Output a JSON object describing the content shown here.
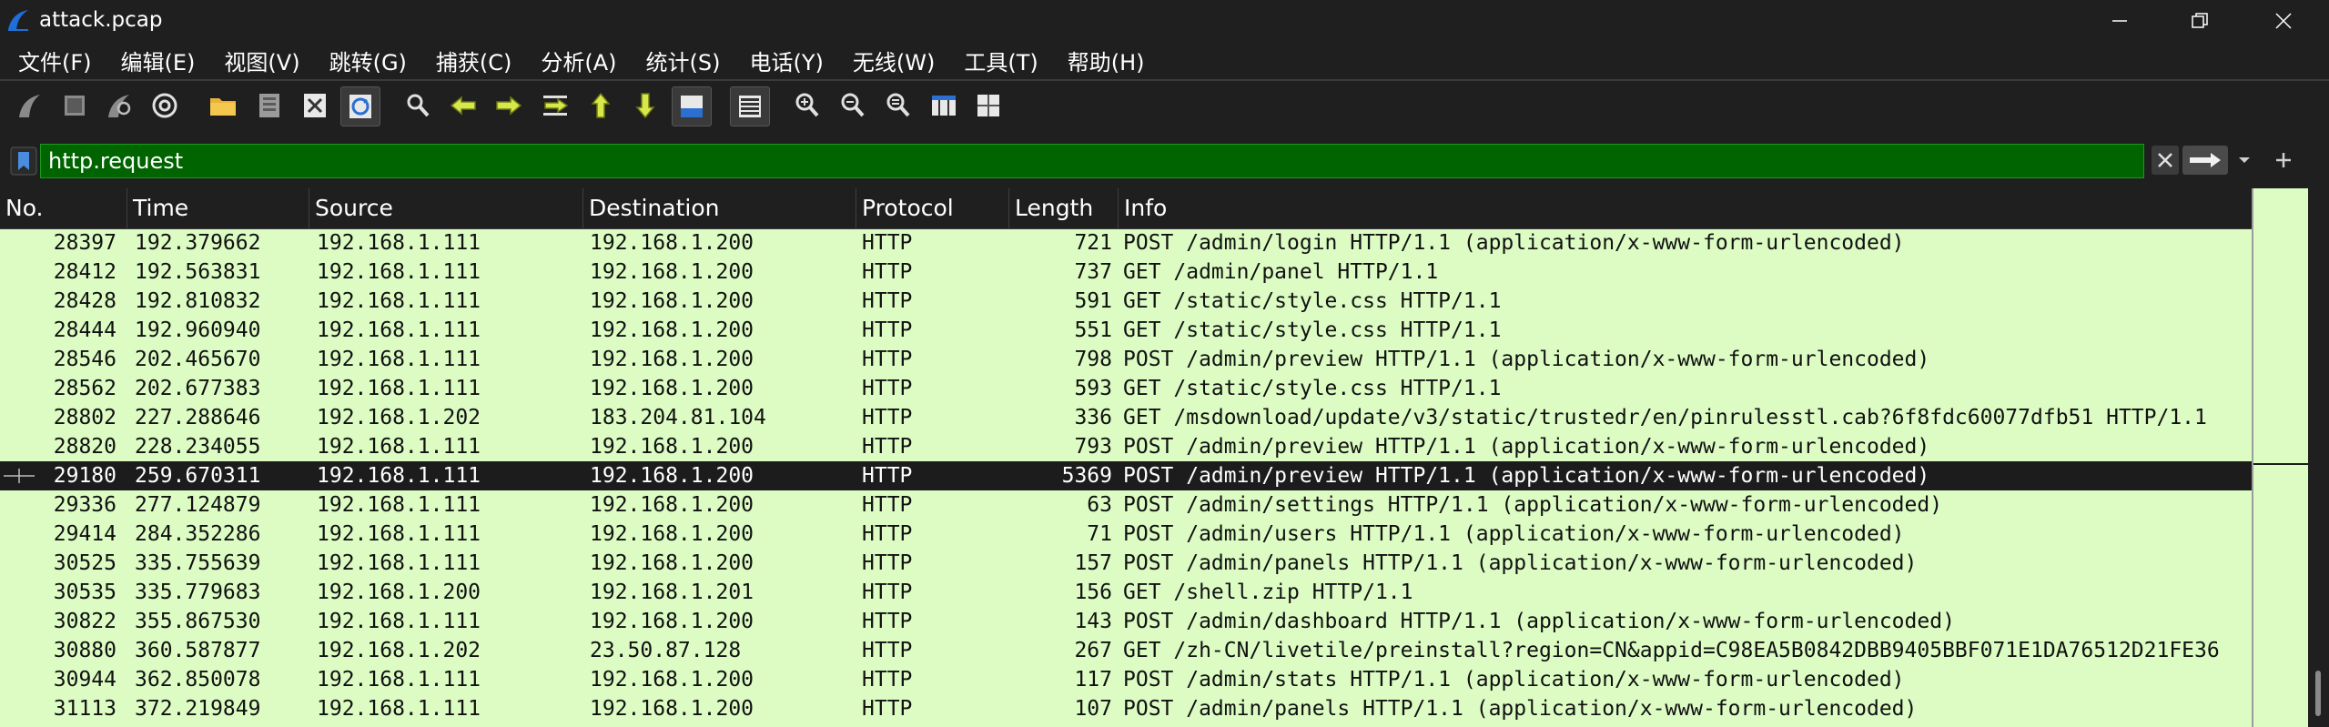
{
  "window": {
    "title": "attack.pcap"
  },
  "menu": [
    "文件(F)",
    "编辑(E)",
    "视图(V)",
    "跳转(G)",
    "捕获(C)",
    "分析(A)",
    "统计(S)",
    "电话(Y)",
    "无线(W)",
    "工具(T)",
    "帮助(H)"
  ],
  "toolbar_icons": [
    "start-capture-icon",
    "stop-capture-icon",
    "restart-capture-icon",
    "capture-options-icon",
    "open-file-icon",
    "save-file-icon",
    "close-file-icon",
    "reload-file-icon",
    "find-packet-icon",
    "go-back-icon",
    "go-forward-icon",
    "go-to-packet-icon",
    "first-packet-icon",
    "last-packet-icon",
    "auto-scroll-icon",
    "colorize-icon",
    "zoom-in-icon",
    "zoom-out-icon",
    "normal-size-icon",
    "resize-columns-icon"
  ],
  "filter": {
    "value": "http.request"
  },
  "columns": [
    "No.",
    "Time",
    "Source",
    "Destination",
    "Protocol",
    "Length",
    "Info"
  ],
  "packets": [
    {
      "no": "28397",
      "time": "192.379662",
      "src": "192.168.1.111",
      "dst": "192.168.1.200",
      "proto": "HTTP",
      "len": "721",
      "info": "POST /admin/login HTTP/1.1  (application/x-www-form-urlencoded)"
    },
    {
      "no": "28412",
      "time": "192.563831",
      "src": "192.168.1.111",
      "dst": "192.168.1.200",
      "proto": "HTTP",
      "len": "737",
      "info": "GET /admin/panel HTTP/1.1"
    },
    {
      "no": "28428",
      "time": "192.810832",
      "src": "192.168.1.111",
      "dst": "192.168.1.200",
      "proto": "HTTP",
      "len": "591",
      "info": "GET /static/style.css HTTP/1.1"
    },
    {
      "no": "28444",
      "time": "192.960940",
      "src": "192.168.1.111",
      "dst": "192.168.1.200",
      "proto": "HTTP",
      "len": "551",
      "info": "GET /static/style.css HTTP/1.1"
    },
    {
      "no": "28546",
      "time": "202.465670",
      "src": "192.168.1.111",
      "dst": "192.168.1.200",
      "proto": "HTTP",
      "len": "798",
      "info": "POST /admin/preview HTTP/1.1  (application/x-www-form-urlencoded)"
    },
    {
      "no": "28562",
      "time": "202.677383",
      "src": "192.168.1.111",
      "dst": "192.168.1.200",
      "proto": "HTTP",
      "len": "593",
      "info": "GET /static/style.css HTTP/1.1"
    },
    {
      "no": "28802",
      "time": "227.288646",
      "src": "192.168.1.202",
      "dst": "183.204.81.104",
      "proto": "HTTP",
      "len": "336",
      "info": "GET /msdownload/update/v3/static/trustedr/en/pinrulesstl.cab?6f8fdc60077dfb51 HTTP/1.1"
    },
    {
      "no": "28820",
      "time": "228.234055",
      "src": "192.168.1.111",
      "dst": "192.168.1.200",
      "proto": "HTTP",
      "len": "793",
      "info": "POST /admin/preview HTTP/1.1  (application/x-www-form-urlencoded)"
    },
    {
      "no": "29180",
      "time": "259.670311",
      "src": "192.168.1.111",
      "dst": "192.168.1.200",
      "proto": "HTTP",
      "len": "5369",
      "info": "POST /admin/preview HTTP/1.1  (application/x-www-form-urlencoded)",
      "selected": true
    },
    {
      "no": "29336",
      "time": "277.124879",
      "src": "192.168.1.111",
      "dst": "192.168.1.200",
      "proto": "HTTP",
      "len": "63",
      "info": "POST /admin/settings HTTP/1.1  (application/x-www-form-urlencoded)"
    },
    {
      "no": "29414",
      "time": "284.352286",
      "src": "192.168.1.111",
      "dst": "192.168.1.200",
      "proto": "HTTP",
      "len": "71",
      "info": "POST /admin/users HTTP/1.1  (application/x-www-form-urlencoded)"
    },
    {
      "no": "30525",
      "time": "335.755639",
      "src": "192.168.1.111",
      "dst": "192.168.1.200",
      "proto": "HTTP",
      "len": "157",
      "info": "POST /admin/panels HTTP/1.1  (application/x-www-form-urlencoded)"
    },
    {
      "no": "30535",
      "time": "335.779683",
      "src": "192.168.1.200",
      "dst": "192.168.1.201",
      "proto": "HTTP",
      "len": "156",
      "info": "GET /shell.zip HTTP/1.1"
    },
    {
      "no": "30822",
      "time": "355.867530",
      "src": "192.168.1.111",
      "dst": "192.168.1.200",
      "proto": "HTTP",
      "len": "143",
      "info": "POST /admin/dashboard HTTP/1.1  (application/x-www-form-urlencoded)"
    },
    {
      "no": "30880",
      "time": "360.587877",
      "src": "192.168.1.202",
      "dst": "23.50.87.128",
      "proto": "HTTP",
      "len": "267",
      "info": "GET /zh-CN/livetile/preinstall?region=CN&appid=C98EA5B0842DBB9405BBF071E1DA76512D21FE36"
    },
    {
      "no": "30944",
      "time": "362.850078",
      "src": "192.168.1.111",
      "dst": "192.168.1.200",
      "proto": "HTTP",
      "len": "117",
      "info": "POST /admin/stats HTTP/1.1  (application/x-www-form-urlencoded)"
    },
    {
      "no": "31113",
      "time": "372.219849",
      "src": "192.168.1.111",
      "dst": "192.168.1.200",
      "proto": "HTTP",
      "len": "107",
      "info": "POST /admin/panels HTTP/1.1  (application/x-www-form-urlencoded)"
    }
  ],
  "colors": {
    "row_bg": "#dcfcc4",
    "selected_bg": "#1c1c1c",
    "filter_bg": "#006400",
    "chrome_bg": "#1f1f1f"
  }
}
